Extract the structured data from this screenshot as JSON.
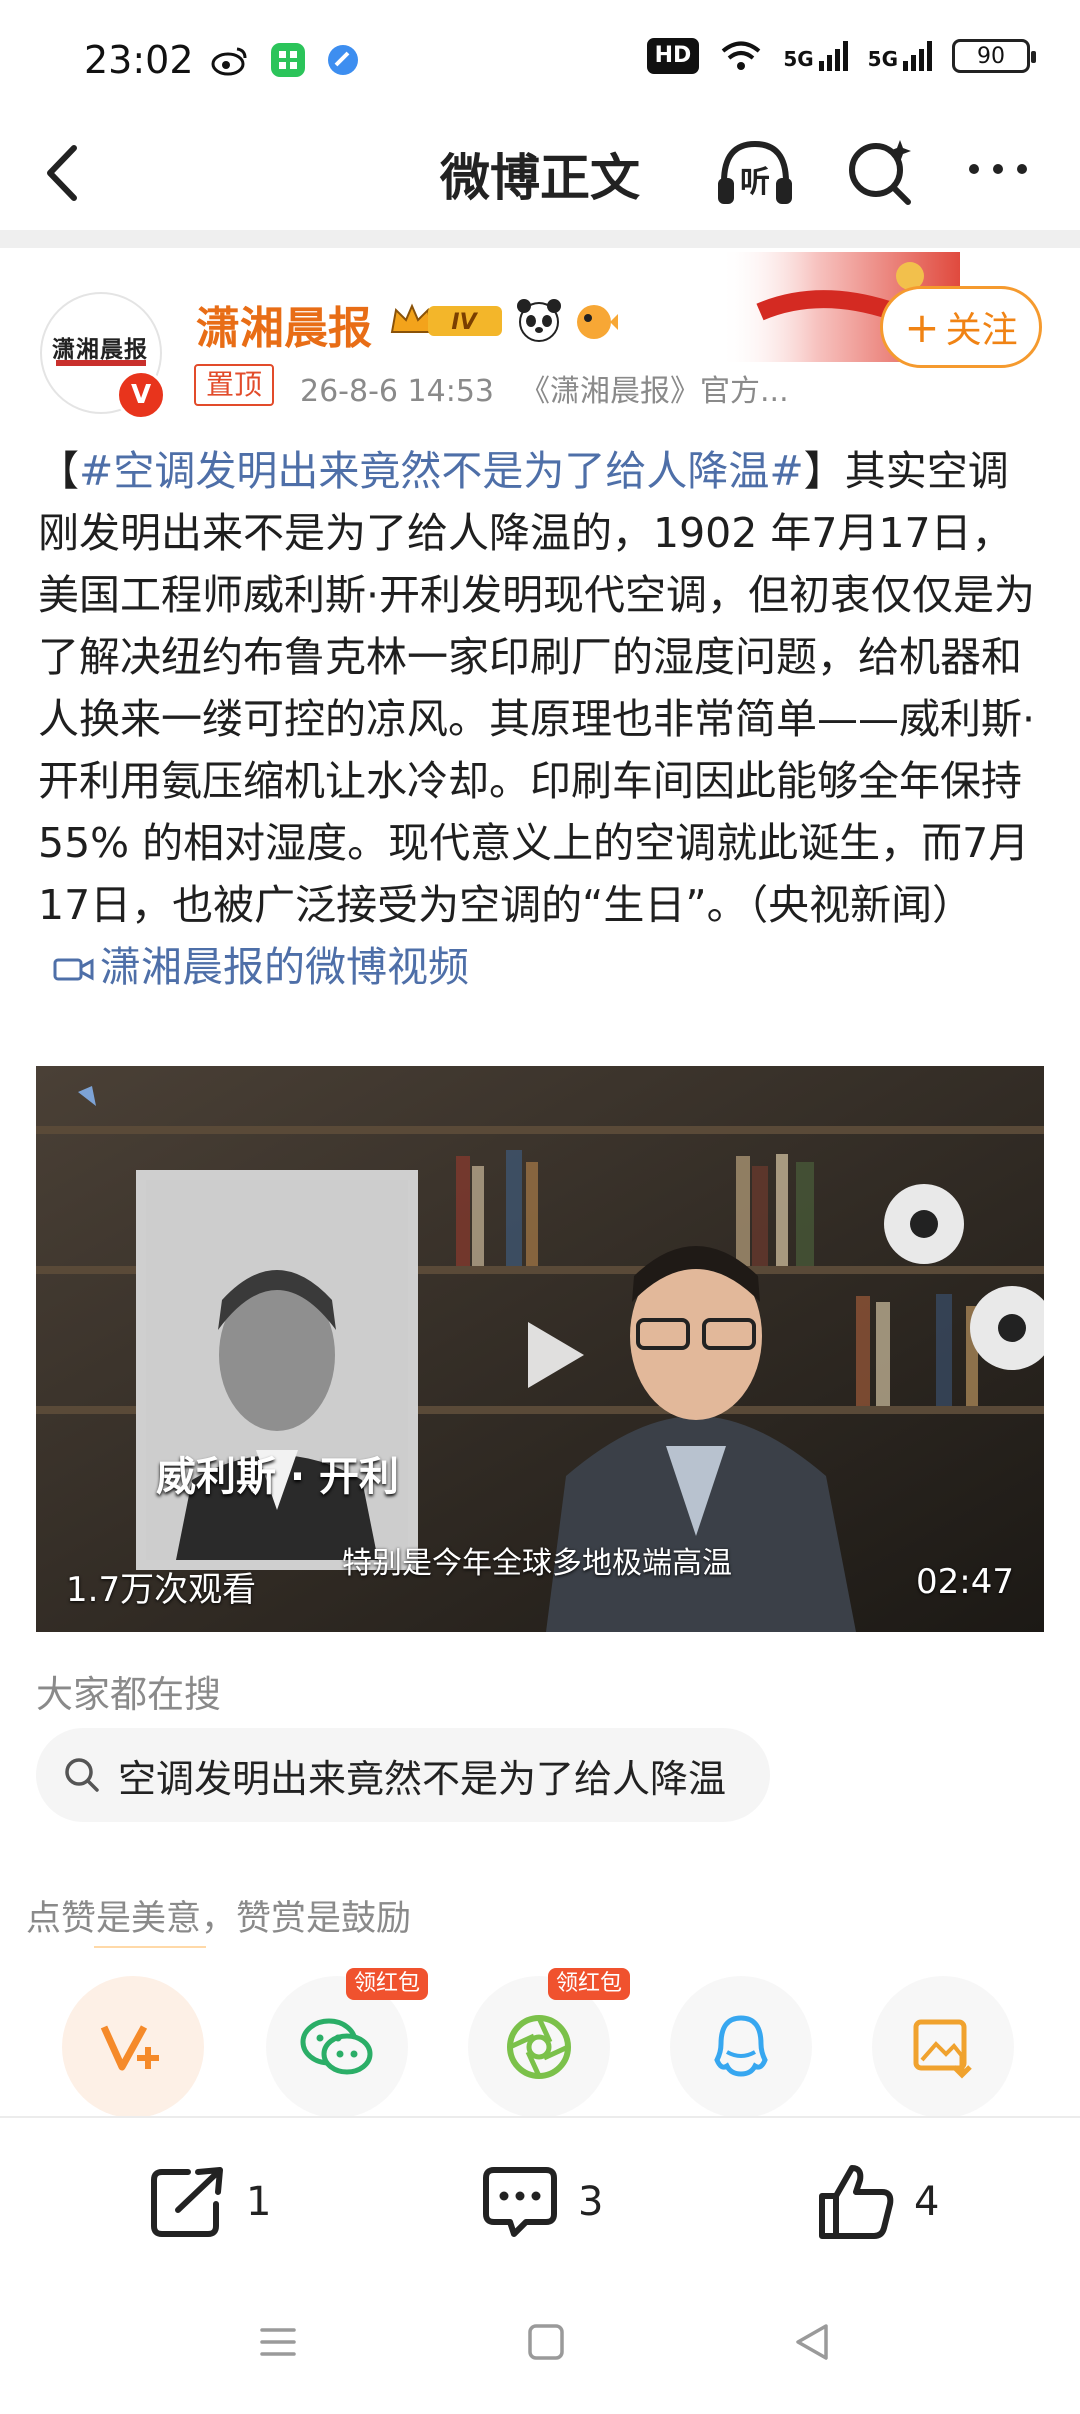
{
  "status_bar": {
    "time": "23:02",
    "hd_label": "HD",
    "net1": "5G",
    "net2": "5G",
    "battery": "90"
  },
  "nav": {
    "title": "微博正文",
    "listen_icon_label": "听"
  },
  "author": {
    "name": "潇湘晨报",
    "avatar_text": "潇湘晨报",
    "level_badge": "IV",
    "verified_mark": "V",
    "follow_label": "关注",
    "pinned_label": "置顶",
    "post_time": "26-8-6 14:53",
    "source": "《潇湘晨报》官方..."
  },
  "post": {
    "bracket_open": "【",
    "hashtag": "#空调发明出来竟然不是为了给人降温#",
    "bracket_close": "】",
    "body": "其实空调刚发明出来不是为了给人降温的，1902 年7月17日，美国工程师威利斯·开利发明现代空调，但初衷仅仅是为了解决纽约布鲁克林一家印刷厂的湿度问题，给机器和人换来一缕可控的凉风。其原理也非常简单——威利斯·开利用氨压缩机让水冷却。印刷车间因此能够全年保持 55% 的相对湿度。现代意义上的空调就此诞生，而7月17日，也被广泛接受为空调的“生日”。（央视新闻）",
    "video_link": "潇湘晨报的微博视频"
  },
  "video": {
    "portrait_caption": "威利斯 · 开利",
    "subtitle": "特别是今年全球多地极端高温",
    "views": "1.7万次观看",
    "duration": "02:47"
  },
  "trending": {
    "label": "大家都在搜",
    "query": "空调发明出来竟然不是为了给人降温"
  },
  "tip": {
    "label": "点赞是美意，赞赏是鼓励",
    "redpack_label": "领红包",
    "buttons": [
      "vip-charge",
      "wechat",
      "moments",
      "qq",
      "save-image"
    ]
  },
  "actions": {
    "repost_count": "1",
    "comment_count": "3",
    "like_count": "4"
  },
  "colors": {
    "author_name": "#e86d16",
    "link_blue": "#4e6fa8",
    "follow_orange": "#f08314",
    "redpack_red": "#f0522e"
  }
}
